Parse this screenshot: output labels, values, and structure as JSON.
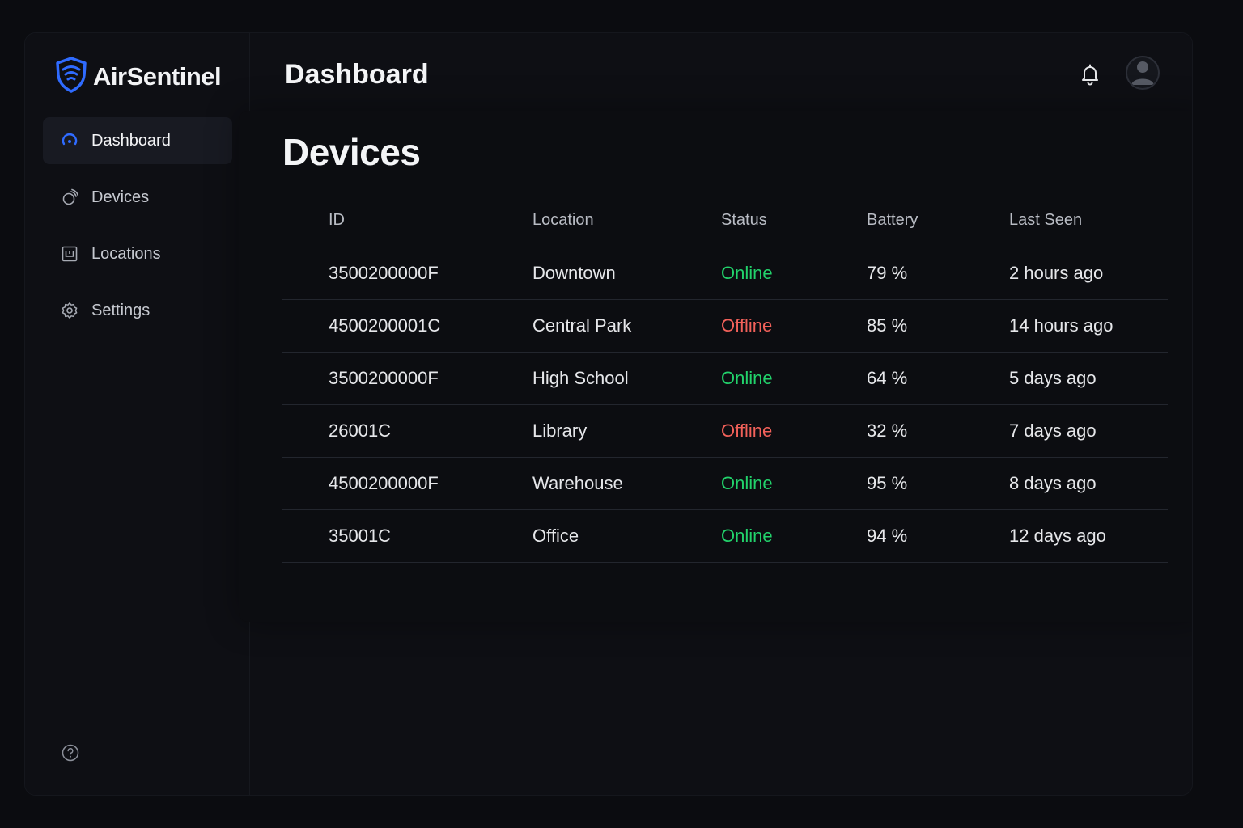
{
  "brand": {
    "name": "AirSentinel",
    "icon": "shield-wifi-icon",
    "color": "#2f6bff"
  },
  "sidebar": {
    "items": [
      {
        "label": "Dashboard",
        "icon": "dashboard-icon",
        "active": true
      },
      {
        "label": "Devices",
        "icon": "devices-icon",
        "active": false
      },
      {
        "label": "Locations",
        "icon": "locations-icon",
        "active": false
      },
      {
        "label": "Settings",
        "icon": "gear-icon",
        "active": false
      }
    ],
    "help_icon": "help-icon"
  },
  "header": {
    "title": "Dashboard",
    "bell_icon": "bell-icon",
    "avatar_icon": "user-icon"
  },
  "main": {
    "title": "Devices",
    "table": {
      "columns": [
        "ID",
        "Location",
        "Status",
        "Battery",
        "Last Seen"
      ],
      "rows": [
        {
          "id": "3500200000F",
          "location": "Downtown",
          "status": "Online",
          "battery": "79 %",
          "last_seen": "2 hours ago"
        },
        {
          "id": "4500200001C",
          "location": "Central Park",
          "status": "Offline",
          "battery": "85 %",
          "last_seen": "14 hours ago"
        },
        {
          "id": "3500200000F",
          "location": "High School",
          "status": "Online",
          "battery": "64 %",
          "last_seen": "5 days ago"
        },
        {
          "id": "26001C",
          "location": "Library",
          "status": "Offline",
          "battery": "32 %",
          "last_seen": "7 days ago"
        },
        {
          "id": "4500200000F",
          "location": "Warehouse",
          "status": "Online",
          "battery": "95 %",
          "last_seen": "8 days ago"
        },
        {
          "id": "35001C",
          "location": "Office",
          "status": "Online",
          "battery": "94 %",
          "last_seen": "12 days ago"
        }
      ]
    }
  },
  "colors": {
    "online": "#22d26b",
    "offline": "#f2615a",
    "accent": "#2f6bff"
  }
}
